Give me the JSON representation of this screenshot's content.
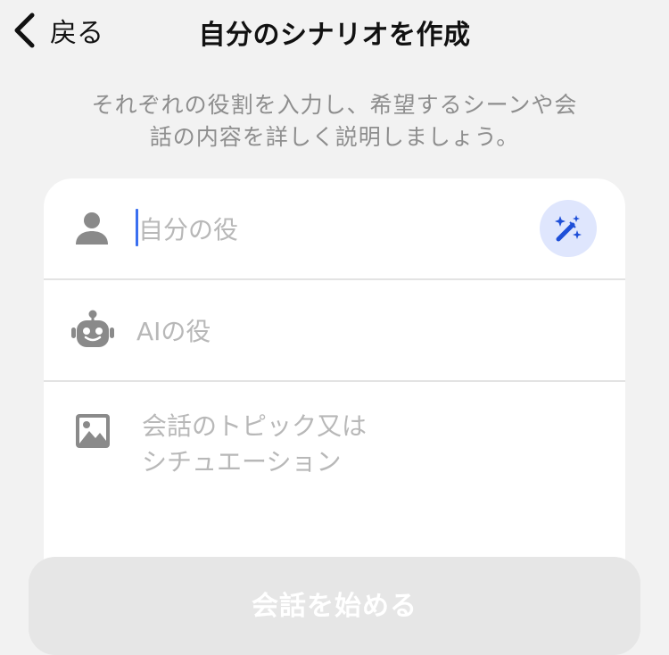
{
  "header": {
    "back_label": "戻る",
    "title": "自分のシナリオを作成"
  },
  "description": {
    "line1": "それぞれの役割を入力し、希望するシーンや会",
    "line2": "話の内容を詳しく説明しましょう。"
  },
  "form": {
    "self_role": {
      "placeholder": "自分の役",
      "value": "",
      "icon": "person-icon",
      "action_icon": "magic-wand-icon"
    },
    "ai_role": {
      "placeholder": "AIの役",
      "value": "",
      "icon": "robot-icon"
    },
    "topic": {
      "placeholder": "会話のトピック又は\nシチュエーション",
      "value": "",
      "icon": "image-icon"
    }
  },
  "start_button": {
    "label": "会話を始める"
  },
  "colors": {
    "background": "#f2f2f2",
    "card": "#ffffff",
    "accent": "#3a6ff0",
    "accent_soft": "#dfe6fd",
    "placeholder": "#b8b8b8",
    "icon_gray": "#8a8a8a",
    "button_disabled": "#e6e6e6"
  }
}
